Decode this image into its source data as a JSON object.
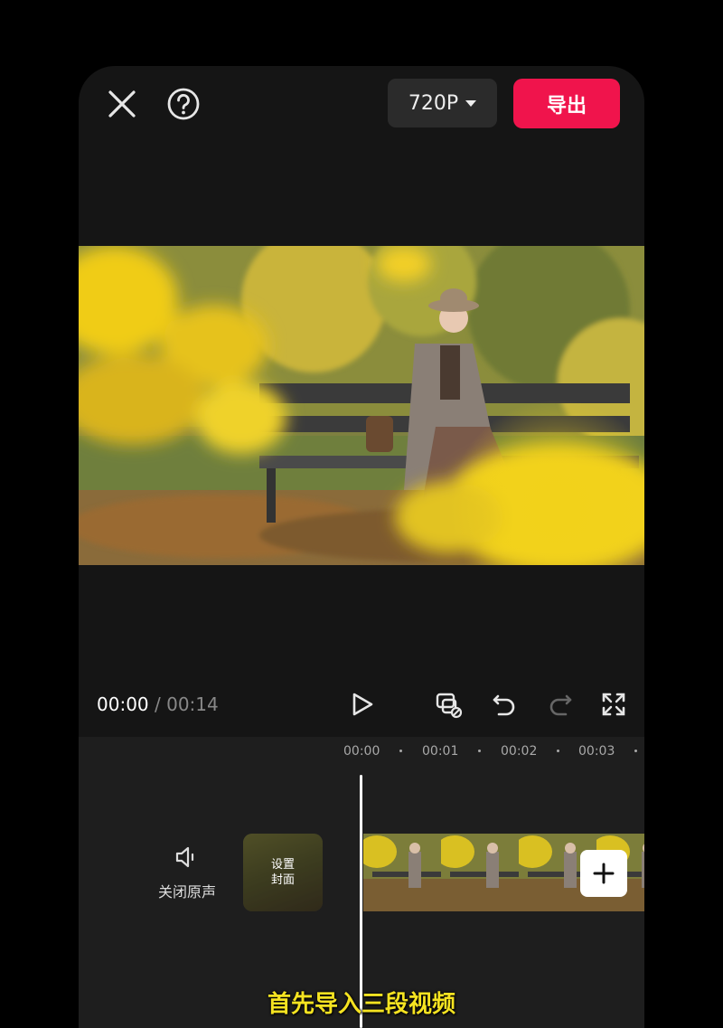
{
  "toolbar": {
    "resolution_label": "720P",
    "export_label": "导出"
  },
  "playback": {
    "current_time": "00:00",
    "separator": "/",
    "total_time": "00:14"
  },
  "ruler": {
    "ticks": [
      "00:00",
      "00:01",
      "00:02",
      "00:03"
    ]
  },
  "track": {
    "mute_label": "关闭原声",
    "cover_label": "设置封面",
    "clip_count": 4
  },
  "subtitle": "首先导入三段视频",
  "colors": {
    "accent": "#f0144c",
    "subtitle": "#f5e321",
    "panel": "#151515"
  }
}
